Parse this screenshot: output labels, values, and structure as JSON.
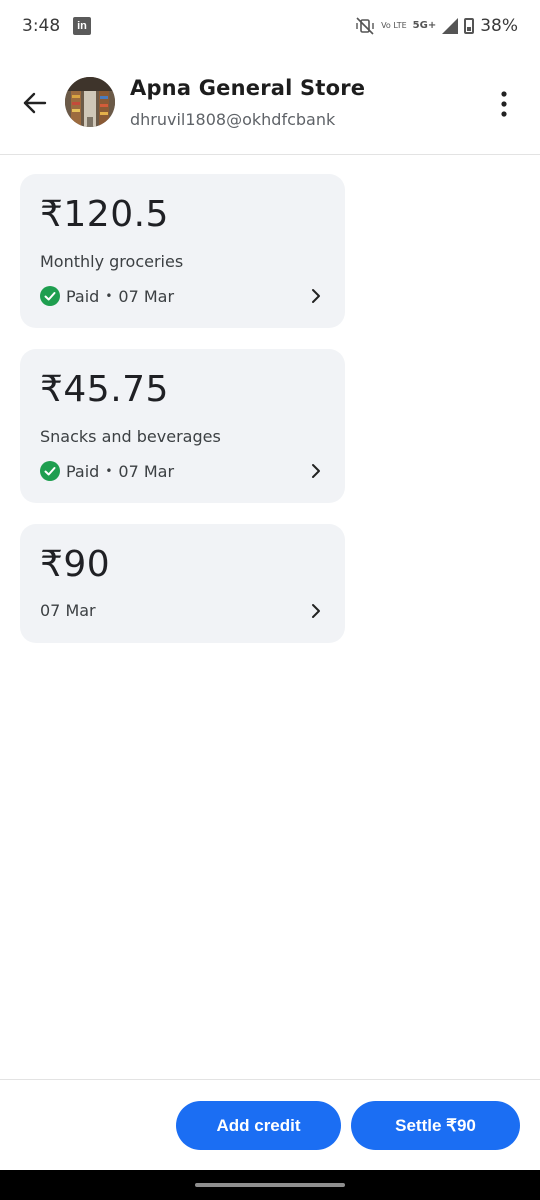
{
  "status_bar": {
    "time": "3:48",
    "app_icon": "LinkedIn",
    "volte": "Vo LTE",
    "network": "5G+",
    "battery": "38%"
  },
  "header": {
    "store_name": "Apna General Store",
    "upi_id": "dhruvil1808@okhdfcbank"
  },
  "transactions": [
    {
      "amount": "₹120.5",
      "description": "Monthly groceries",
      "status": "Paid",
      "date": "07 Mar"
    },
    {
      "amount": "₹45.75",
      "description": "Snacks and beverages",
      "status": "Paid",
      "date": "07 Mar"
    },
    {
      "amount": "₹90",
      "date": "07 Mar"
    }
  ],
  "actions": {
    "add_credit": "Add credit",
    "settle": "Settle ₹90"
  },
  "colors": {
    "primary_button": "#1b6ef3",
    "paid_check": "#1e9e4f",
    "card_background": "#f1f3f6"
  }
}
